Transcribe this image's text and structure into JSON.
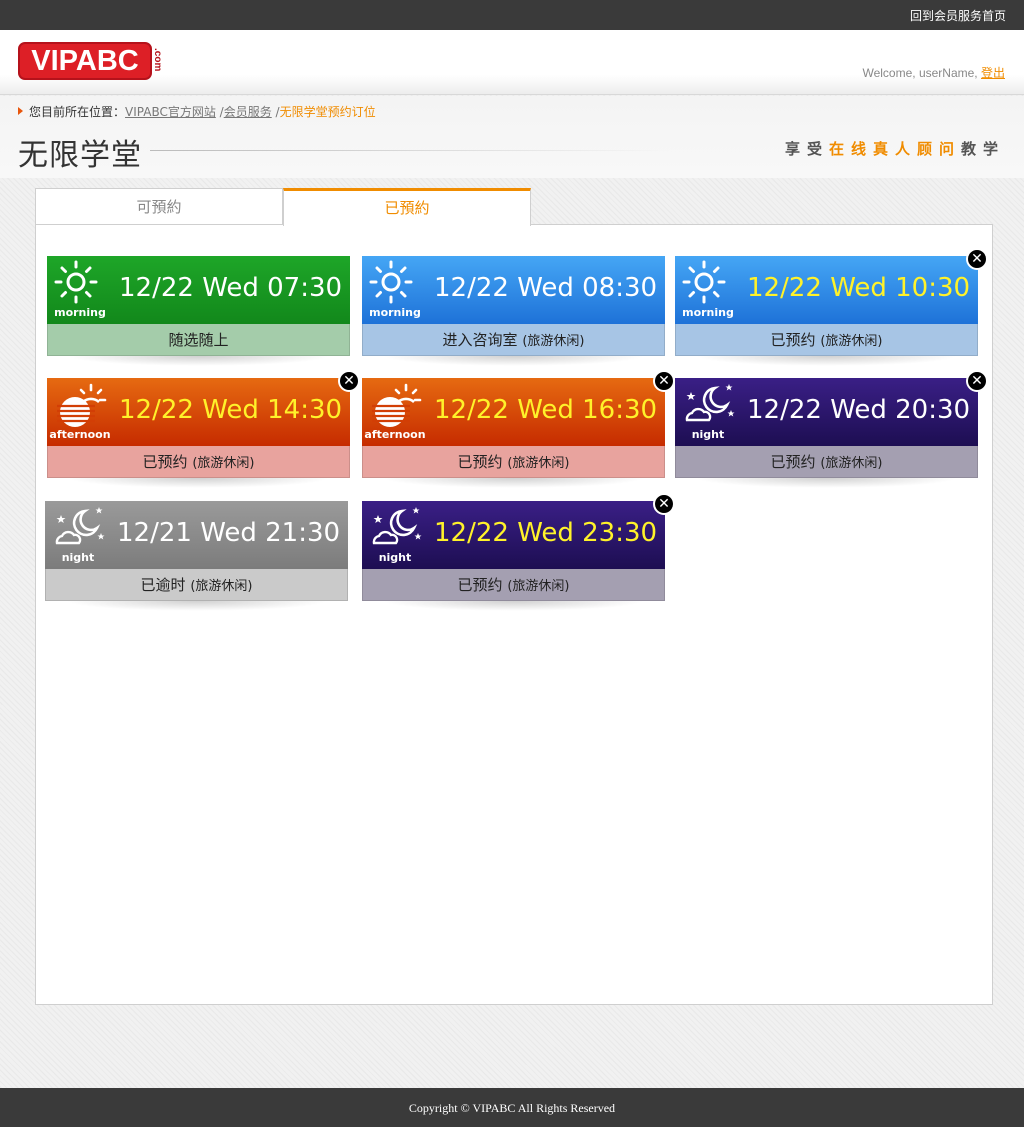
{
  "topbar": {
    "home_link": "回到会员服务首页"
  },
  "header": {
    "logo_text": "VIPABC",
    "logo_suffix": ".com",
    "welcome_text": "Welcome, userName,",
    "logout_label": "登出"
  },
  "breadcrumb": {
    "prefix": "您目前所在位置：",
    "items": [
      "VIPABC官方网站",
      "会员服务"
    ],
    "current": "无限学堂预约订位"
  },
  "page": {
    "title": "无限学堂",
    "slogan_pre": "享受",
    "slogan_hl": "在线真人顾问",
    "slogan_post": "教学"
  },
  "tabs": [
    {
      "label": "可預約",
      "active": false
    },
    {
      "label": "已預約",
      "active": true
    }
  ],
  "colors": {
    "accent": "#f08c00",
    "brand": "#dd1f26"
  },
  "cards": [
    {
      "period": "morning",
      "icon": "sun-icon",
      "time": "12/22 Wed 07:30",
      "status": "随选随上",
      "note": "",
      "theme": "green",
      "yellow": false,
      "closable": false
    },
    {
      "period": "morning",
      "icon": "sun-icon",
      "time": "12/22 Wed 08:30",
      "status": "进入咨询室",
      "note": "(旅游休闲)",
      "theme": "blue",
      "yellow": false,
      "closable": false
    },
    {
      "period": "morning",
      "icon": "sun-icon",
      "time": "12/22 Wed 10:30",
      "status": "已预约",
      "note": "(旅游休闲)",
      "theme": "blue",
      "yellow": true,
      "closable": true
    },
    {
      "period": "afternoon",
      "icon": "sunset-icon",
      "time": "12/22 Wed 14:30",
      "status": "已预约",
      "note": "(旅游休闲)",
      "theme": "orange",
      "yellow": true,
      "closable": true
    },
    {
      "period": "afternoon",
      "icon": "sunset-icon",
      "time": "12/22 Wed 16:30",
      "status": "已预约",
      "note": "(旅游休闲)",
      "theme": "orange",
      "yellow": true,
      "closable": true
    },
    {
      "period": "night",
      "icon": "moon-icon",
      "time": "12/22 Wed 20:30",
      "status": "已预约",
      "note": "(旅游休闲)",
      "theme": "purple",
      "yellow": false,
      "closable": true
    },
    {
      "period": "night",
      "icon": "moon-icon",
      "time": "12/21 Wed 21:30",
      "status": "已逾时",
      "note": "(旅游休闲)",
      "theme": "gray",
      "yellow": false,
      "closable": false
    },
    {
      "period": "night",
      "icon": "moon-icon",
      "time": "12/22 Wed 23:30",
      "status": "已预约",
      "note": "(旅游休闲)",
      "theme": "purple",
      "yellow": true,
      "closable": true
    }
  ],
  "footer": {
    "copyright": "Copyright © VIPABC All Rights Reserved"
  }
}
